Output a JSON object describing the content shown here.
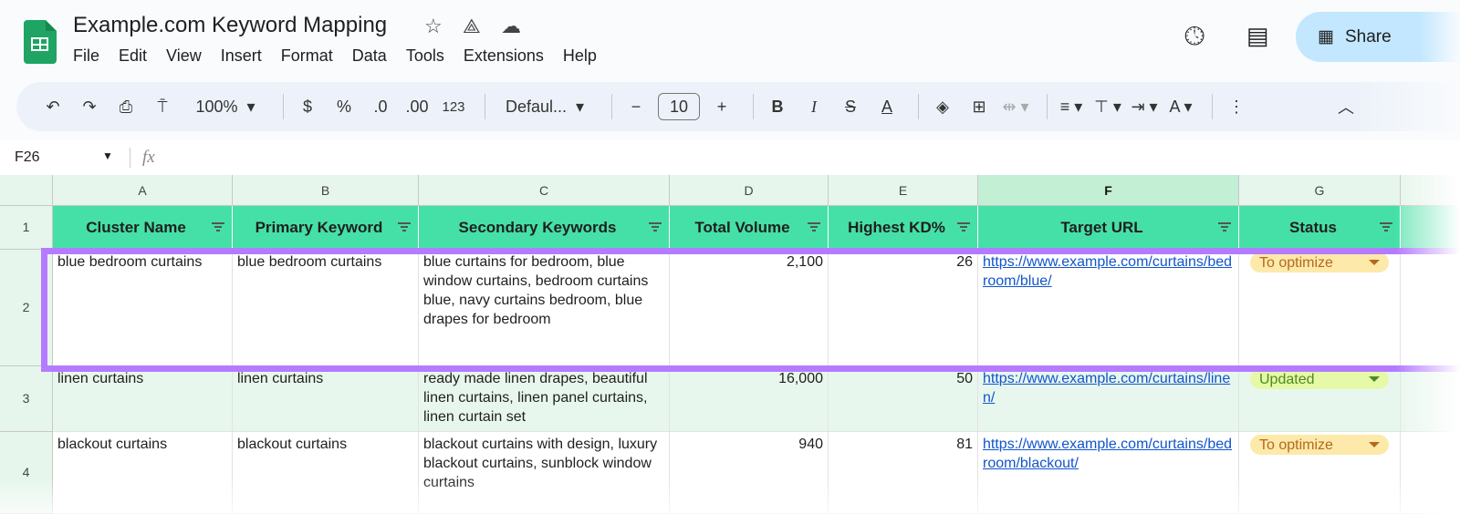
{
  "app": {
    "title": "Example.com Keyword Mapping",
    "icons": [
      "star-icon",
      "move-to-drive-icon",
      "cloud-saved-icon"
    ],
    "menu": [
      "File",
      "Edit",
      "View",
      "Insert",
      "Format",
      "Data",
      "Tools",
      "Extensions",
      "Help"
    ],
    "share_label": "Share"
  },
  "toolbar": {
    "zoom": "100%",
    "currency": "$",
    "percent": "%",
    "decrease_decimal": ".0",
    "increase_decimal": ".00",
    "number_format": "123",
    "font": "Defaul...",
    "font_size": "10"
  },
  "formula_bar": {
    "cell_ref": "F26",
    "fx": "fx"
  },
  "sheet": {
    "columns": [
      "A",
      "B",
      "C",
      "D",
      "E",
      "F",
      "G"
    ],
    "selected_column": "F",
    "headers": [
      "Cluster Name",
      "Primary Keyword",
      "Secondary Keywords",
      "Total Volume",
      "Highest KD%",
      "Target URL",
      "Status"
    ],
    "rows": [
      {
        "num": "2",
        "cluster": "blue bedroom curtains",
        "primary": "blue bedroom curtains",
        "secondary": "blue curtains for bedroom, blue window curtains, bedroom curtains blue, navy curtains bedroom, blue drapes for bedroom",
        "volume": "2,100",
        "kd": "26",
        "url": "https://www.example.com/curtains/bedroom/blue/",
        "status": "To optimize"
      },
      {
        "num": "3",
        "cluster": "linen curtains",
        "primary": "linen curtains",
        "secondary": "ready made linen drapes, beautiful linen curtains, linen panel curtains, linen curtain set",
        "volume": "16,000",
        "kd": "50",
        "url": "https://www.example.com/curtains/linen/",
        "status": "Updated"
      },
      {
        "num": "4",
        "cluster": "blackout curtains",
        "primary": "blackout curtains",
        "secondary": "blackout curtains with design, luxury blackout curtains, sunblock window curtains",
        "volume": "940",
        "kd": "81",
        "url": "https://www.example.com/curtains/bedroom/blackout/",
        "status": "To optimize"
      }
    ],
    "header_row_num": "1"
  },
  "colors": {
    "header_bg": "#45e0a8",
    "highlight": "#b57bff",
    "to_optimize_bg": "#fde9a9",
    "to_optimize_text": "#b3691e",
    "updated_bg": "#e6f9a8",
    "updated_text": "#4d8a1e",
    "link": "#1155cc"
  }
}
